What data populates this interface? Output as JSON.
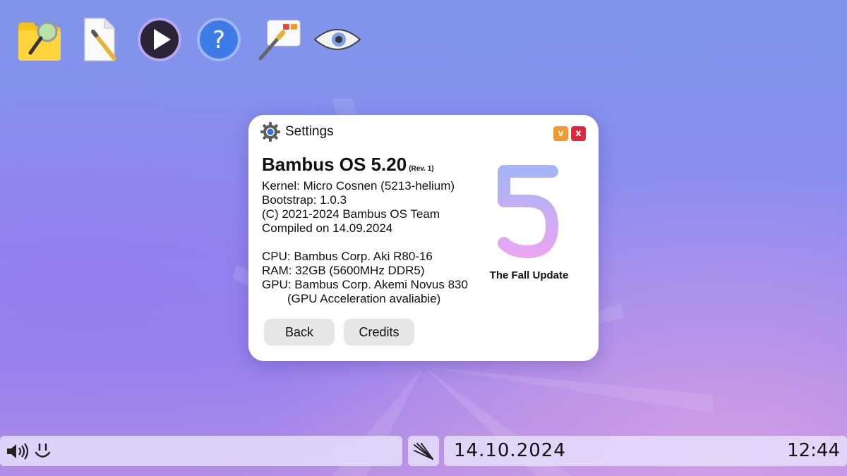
{
  "desktop": {
    "icons": [
      {
        "name": "file-search-icon"
      },
      {
        "name": "text-editor-icon"
      },
      {
        "name": "media-player-icon"
      },
      {
        "name": "help-icon"
      },
      {
        "name": "paint-icon"
      },
      {
        "name": "eye-icon"
      }
    ]
  },
  "settings_window": {
    "title": "Settings",
    "os_name": "Bambus OS 5.20",
    "os_rev": "(Rev. 1)",
    "info_lines": {
      "kernel": "Kernel: Micro Cosnen (5213-helium)",
      "bootstrap": "Bootstrap: 1.0.3",
      "copyright": "(C) 2021-2024 Bambus OS Team",
      "compiled": "Compiled on 14.09.2024",
      "cpu": "CPU: Bambus Corp. Aki R80-16",
      "ram": "RAM: 32GB (5600MHz DDR5)",
      "gpu": "GPU: Bambus Corp. Akemi Novus 830",
      "gpu_note": "(GPU Acceleration avaliabie)"
    },
    "tagline": "The Fall Update",
    "back_label": "Back",
    "credits_label": "Credits",
    "minimize_glyph": "v",
    "close_glyph": "x"
  },
  "taskbar": {
    "date": "14.10.2024",
    "time": "12:44"
  },
  "colors": {
    "accent_orange": "#f29a2e",
    "close_red": "#e2263b",
    "logo_gradient_top": "#a7b4f5",
    "logo_gradient_bottom": "#e9a6f2"
  }
}
